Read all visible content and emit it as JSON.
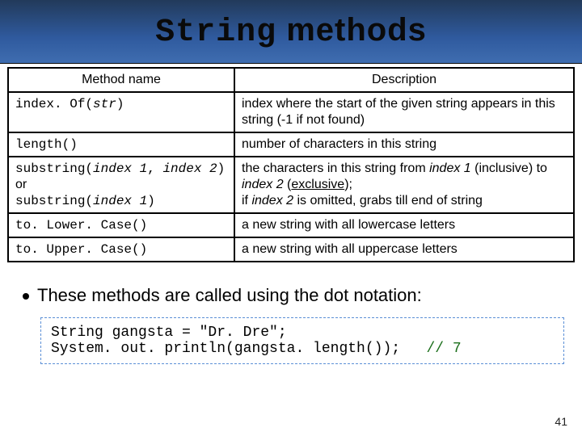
{
  "title": {
    "mono": "String",
    "rest": " methods"
  },
  "table": {
    "headers": {
      "method": "Method name",
      "desc": "Description"
    },
    "rows": [
      {
        "method_html": "index. Of(<span class='ital'>str</span>)",
        "desc_html": "index where the start of the given string appears in this string (-1 if not found)"
      },
      {
        "method_html": "length()",
        "desc_html": "number of characters in this string"
      },
      {
        "method_html": "substring(<span class='ital'>index 1</span>, <span class='ital'>index 2</span>)<br><span style='font-family:Trebuchet MS,sans-serif'>or</span><br>substring(<span class='ital'>index 1</span>)",
        "desc_html": "the characters in this string from <span class='ital'>index 1</span> (inclusive) to <span class='ital'>index 2</span> (<span class='und'>exclusive</span>);<br>if <span class='ital'>index 2</span> is omitted, grabs till end of string"
      },
      {
        "method_html": "to. Lower. Case()",
        "desc_html": "a new string with all lowercase letters"
      },
      {
        "method_html": "to. Upper. Case()",
        "desc_html": "a new string with all uppercase letters"
      }
    ]
  },
  "bullet": "These methods are called using the dot notation:",
  "code": {
    "line1": "String gangsta = \"Dr. Dre\";",
    "line2a": "System. out. println(gangsta. length());",
    "line2b": "// 7"
  },
  "page": "41"
}
